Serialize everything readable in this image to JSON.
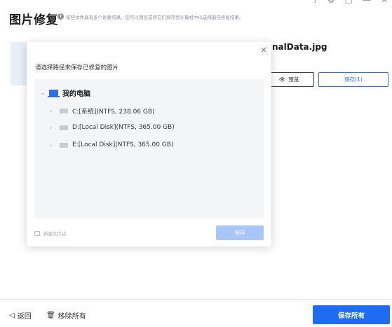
{
  "header": {
    "title": "图片修复",
    "subtitle": "某些文件具有多个修复结果。您可以预览或将它们保存到计算机中以选择最佳修复结果。"
  },
  "file": {
    "name": "nalData.jpg",
    "preview_label": "预览",
    "save_label": "保存(1)"
  },
  "modal": {
    "title": "请选择路径来保存已修复的图片",
    "root_label": "我的电脑",
    "drives": [
      {
        "label": "C:[系统](NTFS, 238.06  GB)"
      },
      {
        "label": "D:[Local Disk](NTFS, 365.00  GB)"
      },
      {
        "label": "E:[Local Disk](NTFS, 365.00  GB)"
      }
    ],
    "new_folder_label": "新建文件夹",
    "save_label": "保存"
  },
  "footer": {
    "back_label": "返回",
    "remove_all_label": "移除所有",
    "save_all_label": "保存所有"
  },
  "icons": {
    "info": "info-icon",
    "close": "close-icon",
    "eye": "eye-icon",
    "computer": "computer-icon",
    "drive": "drive-icon",
    "folder": "new-folder-icon",
    "back": "back-icon",
    "trash": "trash-icon"
  },
  "colors": {
    "accent": "#1f6cf0",
    "disabled_accent": "#a8c7f8",
    "tree_bg": "#f4f5f7"
  }
}
